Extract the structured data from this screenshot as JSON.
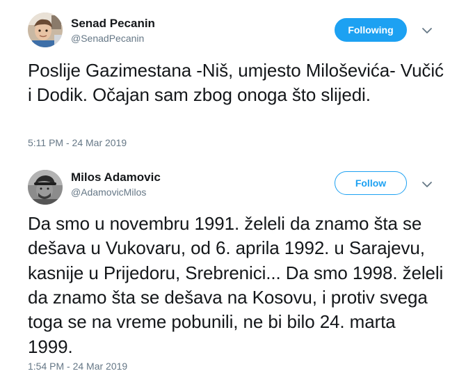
{
  "tweets": [
    {
      "author_name": "Senad Pecanin",
      "author_handle": "@SenadPecanin",
      "follow_state": "Following",
      "text": "Poslije Gazimestana -Niš, umjesto Miloševića- Vučić i Dodik. Očajan sam zbog onoga što slijedi.",
      "timestamp": "5:11 PM - 24 Mar 2019",
      "avatar_icon": "profile-photo-child-icon",
      "menu_icon": "chevron-down-icon"
    },
    {
      "author_name": "Milos Adamovic",
      "author_handle": "@AdamovicMilos",
      "follow_state": "Follow",
      "text": "Da smo u novembru 1991. želeli da znamo šta se dešava u Vukovaru, od 6. aprila 1992. u Sarajevu, kasnije u Prijedoru, Srebrenici... Da smo 1998. želeli da znamo šta se dešava na Kosovu, i protiv svega toga se na vreme pobunili, ne bi bilo 24. marta 1999.",
      "timestamp": "1:54 PM - 24 Mar 2019",
      "avatar_icon": "profile-photo-man-cap-icon",
      "menu_icon": "chevron-down-icon"
    }
  ],
  "colors": {
    "accent": "#1da1f2",
    "text": "#14171a",
    "secondary_text": "#657786"
  }
}
